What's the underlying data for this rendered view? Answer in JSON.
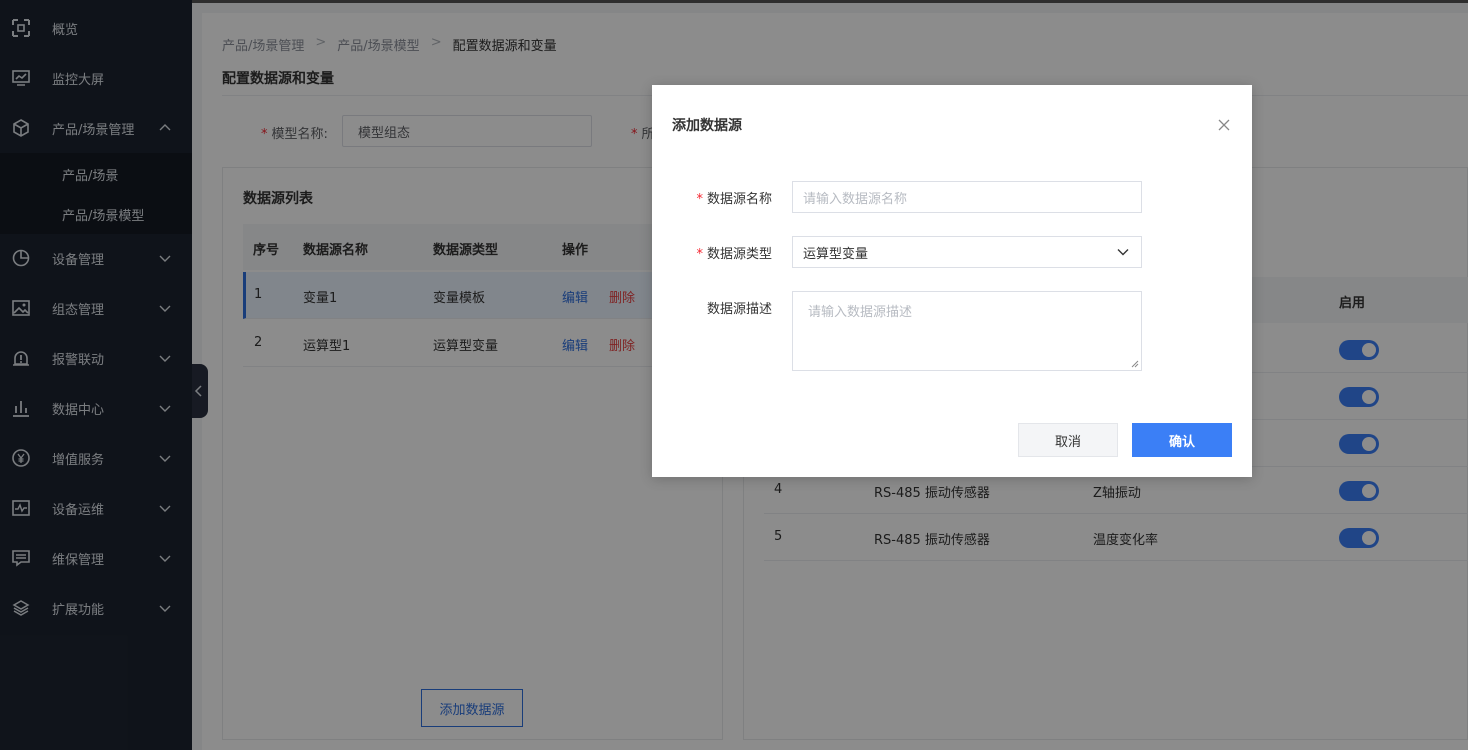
{
  "sidebar": {
    "items": [
      {
        "label": "概览",
        "icon": "overview-icon"
      },
      {
        "label": "监控大屏",
        "icon": "monitor-icon"
      },
      {
        "label": "产品/场景管理",
        "icon": "cube-icon"
      },
      {
        "label": "设备管理",
        "icon": "pie-icon"
      },
      {
        "label": "组态管理",
        "icon": "image-icon"
      },
      {
        "label": "报警联动",
        "icon": "alarm-icon"
      },
      {
        "label": "数据中心",
        "icon": "bar-chart-icon"
      },
      {
        "label": "增值服务",
        "icon": "yen-icon"
      },
      {
        "label": "设备运维",
        "icon": "pulse-icon"
      },
      {
        "label": "维保管理",
        "icon": "message-icon"
      },
      {
        "label": "扩展功能",
        "icon": "layers-icon"
      }
    ],
    "sub_items": [
      "产品/场景",
      "产品/场景模型"
    ]
  },
  "breadcrumb": [
    "产品/场景管理",
    "产品/场景模型",
    "配置数据源和变量"
  ],
  "page_title": "配置数据源和变量",
  "form": {
    "model_name_label": "模型名称:",
    "model_name_value": "模型组态",
    "second_label_partial": "所"
  },
  "datasource_panel": {
    "title": "数据源列表",
    "columns": [
      "序号",
      "数据源名称",
      "数据源类型",
      "操作"
    ],
    "rows": [
      {
        "no": "1",
        "name": "变量1",
        "type": "变量模板",
        "edit": "编辑",
        "delete": "删除"
      },
      {
        "no": "2",
        "name": "运算型1",
        "type": "运算型变量",
        "edit": "编辑",
        "delete": "删除"
      }
    ],
    "add_button": "添加数据源"
  },
  "variable_panel": {
    "enable_header": "启用",
    "rows": [
      {
        "no": "4",
        "device": "RS-485 振动传感器",
        "variable": "Z轴振动",
        "enabled": true
      },
      {
        "no": "5",
        "device": "RS-485 振动传感器",
        "variable": "温度变化率",
        "enabled": true
      }
    ],
    "toggles_enabled": [
      true,
      true,
      true,
      true,
      true
    ]
  },
  "modal": {
    "title": "添加数据源",
    "name_label": "数据源名称",
    "name_placeholder": "请输入数据源名称",
    "type_label": "数据源类型",
    "type_value": "运算型变量",
    "desc_label": "数据源描述",
    "desc_placeholder": "请输入数据源描述",
    "cancel": "取消",
    "confirm": "确认"
  },
  "colors": {
    "sidebar_bg": "#1d2431",
    "primary": "#3b7ff6",
    "danger": "#e84040"
  }
}
